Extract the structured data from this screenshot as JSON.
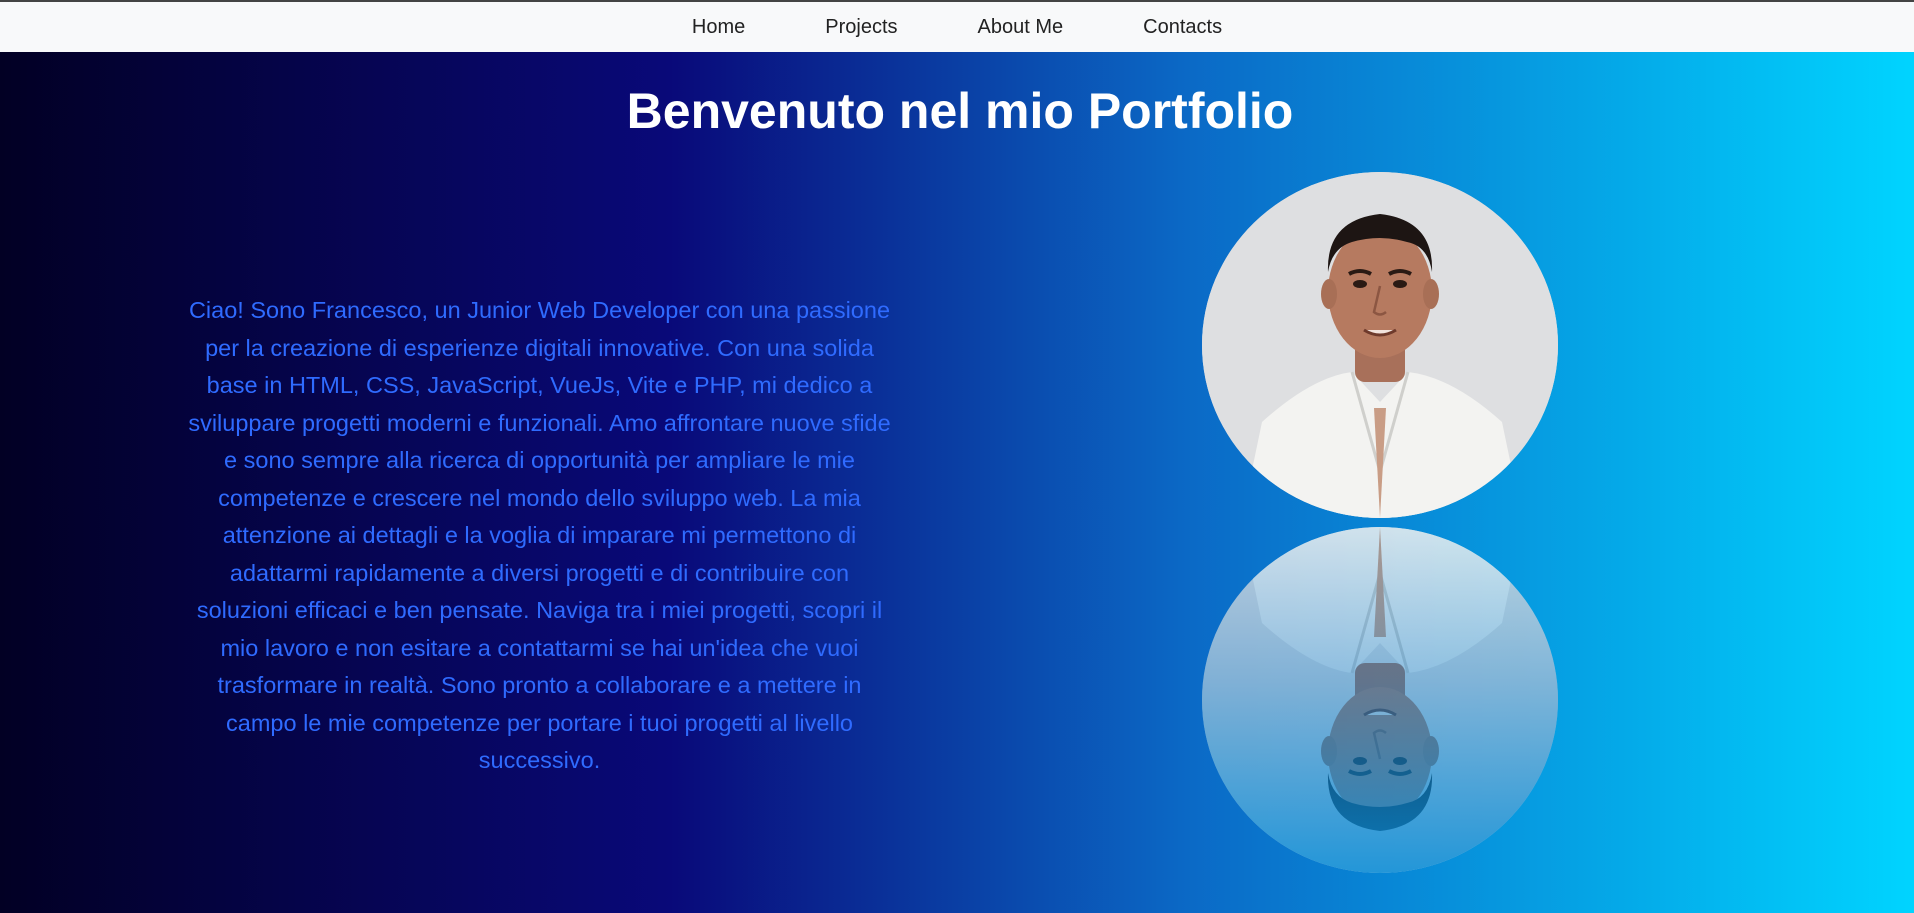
{
  "nav": {
    "items": [
      {
        "label": "Home"
      },
      {
        "label": "Projects"
      },
      {
        "label": "About Me"
      },
      {
        "label": "Contacts"
      }
    ]
  },
  "hero": {
    "title": "Benvenuto nel mio Portfolio",
    "intro": "Ciao! Sono Francesco, un Junior Web Developer con una passione per la creazione di esperienze digitali innovative. Con una solida base in HTML, CSS, JavaScript, VueJs, Vite e PHP, mi dedico a sviluppare progetti moderni e funzionali. Amo affrontare nuove sfide e sono sempre alla ricerca di opportunità per ampliare le mie competenze e crescere nel mondo dello sviluppo web. La mia attenzione ai dettagli e la voglia di imparare mi permettono di adattarmi rapidamente a diversi progetti e di contribuire con soluzioni efficaci e ben pensate. Naviga tra i miei progetti, scopri il mio lavoro e non esitare a contattarmi se hai un'idea che vuoi trasformare in realtà. Sono pronto a collaborare e a mettere in campo le mie competenze per portare i tuoi progetti al livello successivo.",
    "photo_icon": "profile-photo",
    "gradient_colors": [
      "#020024",
      "#090979",
      "#0b69c6",
      "#00d4ff"
    ],
    "intro_color": "#2f6bff"
  }
}
